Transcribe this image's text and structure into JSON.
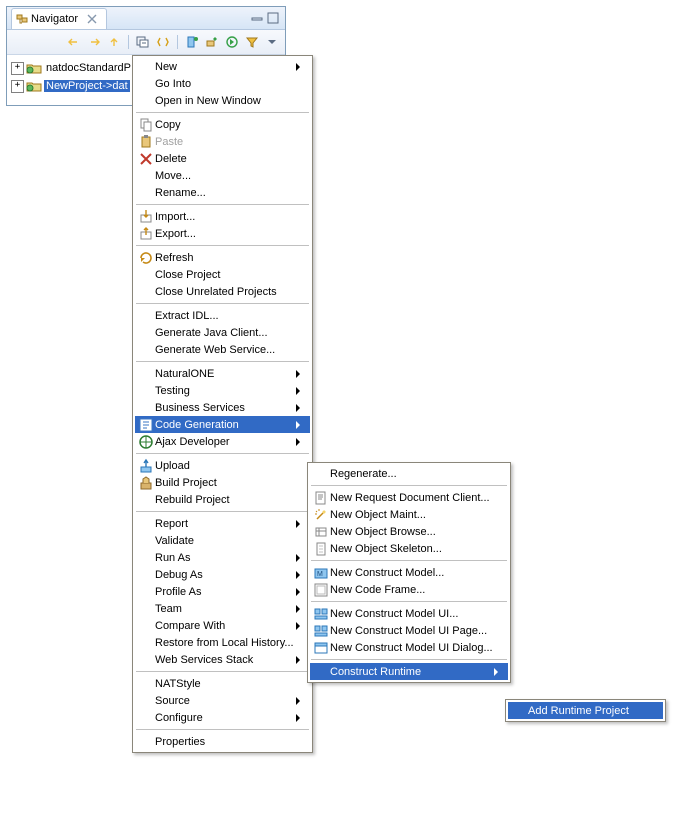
{
  "navigator": {
    "tab_title": "Navigator",
    "tree": [
      {
        "label": "natdocStandardP",
        "selected": false
      },
      {
        "label": "NewProject->dat",
        "selected": true
      }
    ]
  },
  "menu_main": [
    {
      "t": "item",
      "label": "New",
      "submenu": true
    },
    {
      "t": "item",
      "label": "Go Into"
    },
    {
      "t": "item",
      "label": "Open in New Window"
    },
    {
      "t": "sep"
    },
    {
      "t": "item",
      "label": "Copy",
      "icon": "copy"
    },
    {
      "t": "item",
      "label": "Paste",
      "icon": "paste",
      "disabled": true
    },
    {
      "t": "item",
      "label": "Delete",
      "icon": "delete"
    },
    {
      "t": "item",
      "label": "Move..."
    },
    {
      "t": "item",
      "label": "Rename..."
    },
    {
      "t": "sep"
    },
    {
      "t": "item",
      "label": "Import...",
      "icon": "import"
    },
    {
      "t": "item",
      "label": "Export...",
      "icon": "export"
    },
    {
      "t": "sep"
    },
    {
      "t": "item",
      "label": "Refresh",
      "icon": "refresh"
    },
    {
      "t": "item",
      "label": "Close Project"
    },
    {
      "t": "item",
      "label": "Close Unrelated Projects"
    },
    {
      "t": "sep"
    },
    {
      "t": "item",
      "label": "Extract IDL..."
    },
    {
      "t": "item",
      "label": "Generate Java Client..."
    },
    {
      "t": "item",
      "label": "Generate Web Service..."
    },
    {
      "t": "sep"
    },
    {
      "t": "item",
      "label": "NaturalONE",
      "submenu": true
    },
    {
      "t": "item",
      "label": "Testing",
      "submenu": true
    },
    {
      "t": "item",
      "label": "Business Services",
      "submenu": true
    },
    {
      "t": "item",
      "label": "Code Generation",
      "submenu": true,
      "icon": "codegen",
      "highlight": true
    },
    {
      "t": "item",
      "label": "Ajax Developer",
      "submenu": true,
      "icon": "ajax"
    },
    {
      "t": "sep"
    },
    {
      "t": "item",
      "label": "Upload",
      "icon": "upload"
    },
    {
      "t": "item",
      "label": "Build Project",
      "icon": "build"
    },
    {
      "t": "item",
      "label": "Rebuild Project"
    },
    {
      "t": "sep"
    },
    {
      "t": "item",
      "label": "Report",
      "submenu": true
    },
    {
      "t": "item",
      "label": "Validate"
    },
    {
      "t": "item",
      "label": "Run As",
      "submenu": true
    },
    {
      "t": "item",
      "label": "Debug As",
      "submenu": true
    },
    {
      "t": "item",
      "label": "Profile As",
      "submenu": true
    },
    {
      "t": "item",
      "label": "Team",
      "submenu": true
    },
    {
      "t": "item",
      "label": "Compare With",
      "submenu": true
    },
    {
      "t": "item",
      "label": "Restore from Local History..."
    },
    {
      "t": "item",
      "label": "Web Services Stack",
      "submenu": true
    },
    {
      "t": "sep"
    },
    {
      "t": "item",
      "label": "NATStyle"
    },
    {
      "t": "item",
      "label": "Source",
      "submenu": true
    },
    {
      "t": "item",
      "label": "Configure",
      "submenu": true
    },
    {
      "t": "sep"
    },
    {
      "t": "item",
      "label": "Properties"
    }
  ],
  "menu_codegen": [
    {
      "t": "item",
      "label": "Regenerate..."
    },
    {
      "t": "sep"
    },
    {
      "t": "item",
      "label": "New Request Document Client...",
      "icon": "doc"
    },
    {
      "t": "item",
      "label": "New Object Maint...",
      "icon": "wiz"
    },
    {
      "t": "item",
      "label": "New Object Browse...",
      "icon": "wiz2"
    },
    {
      "t": "item",
      "label": "New Object Skeleton...",
      "icon": "skel"
    },
    {
      "t": "sep"
    },
    {
      "t": "item",
      "label": "New Construct Model...",
      "icon": "cm"
    },
    {
      "t": "item",
      "label": "New Code Frame...",
      "icon": "frame"
    },
    {
      "t": "sep"
    },
    {
      "t": "item",
      "label": "New Construct Model UI...",
      "icon": "cmui"
    },
    {
      "t": "item",
      "label": "New Construct Model UI Page...",
      "icon": "cmui"
    },
    {
      "t": "item",
      "label": "New Construct Model UI Dialog...",
      "icon": "cmuid"
    },
    {
      "t": "sep"
    },
    {
      "t": "item",
      "label": "Construct Runtime",
      "submenu": true,
      "highlight": true
    }
  ],
  "menu_runtime": [
    {
      "t": "item",
      "label": "Add Runtime Project"
    }
  ]
}
